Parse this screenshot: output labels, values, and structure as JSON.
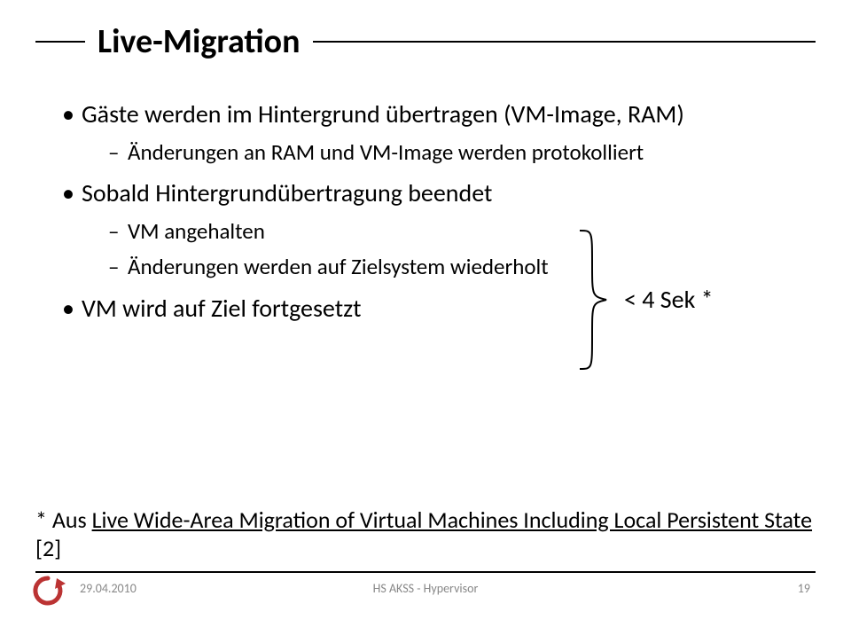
{
  "header": {
    "title": "Live-Migration"
  },
  "bullets": {
    "b1": "Gäste werden im Hintergrund übertragen (VM-Image, RAM)",
    "b1_1": "Änderungen an RAM und VM-Image werden protokolliert",
    "b2": "Sobald Hintergrundübertragung beendet",
    "b2_1": "VM angehalten",
    "b2_2": "Änderungen werden auf Zielsystem wiederholt",
    "b3": "VM wird auf Ziel fortgesetzt"
  },
  "bracket_label": "< 4 Sek *",
  "footnote_prefix": "* Aus ",
  "footnote_link": "Live Wide-Area Migration of Virtual Machines Including Local Persistent State",
  "footnote_suffix": " [2]",
  "footer": {
    "date": "29.04.2010",
    "center": "HS AKSS - Hypervisor",
    "page": "19"
  }
}
